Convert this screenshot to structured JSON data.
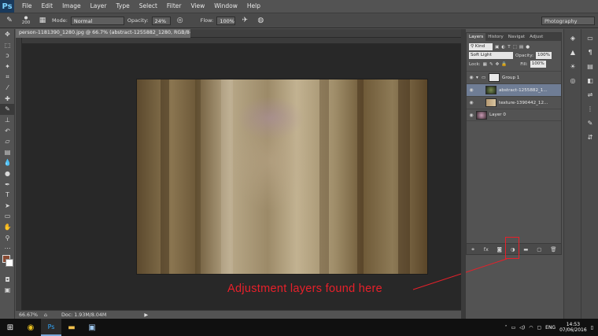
{
  "app": {
    "logo": "Ps"
  },
  "menu": [
    "File",
    "Edit",
    "Image",
    "Layer",
    "Type",
    "Select",
    "Filter",
    "View",
    "Window",
    "Help"
  ],
  "options": {
    "brush_size": "200",
    "mode_label": "Mode:",
    "mode_value": "Normal",
    "opacity_label": "Opacity:",
    "opacity_value": "24%",
    "flow_label": "Flow:",
    "flow_value": "100%",
    "workspace": "Photography"
  },
  "document": {
    "tab_title": "person-1181390_1280.jpg @ 66.7% (abstract-1255882_1280, RGB/8#) *",
    "zoom": "66.67%",
    "doc_info": "Doc: 1.93M/8.04M"
  },
  "layers_panel": {
    "tabs": [
      "Layers",
      "History",
      "Navigat",
      "Adjust"
    ],
    "filter_kind": "Kind",
    "blend_mode": "Soft Light",
    "opacity_label": "Opacity:",
    "opacity_value": "100%",
    "lock_label": "Lock:",
    "fill_label": "Fill:",
    "fill_value": "100%",
    "layers": [
      {
        "name": "Group 1",
        "type": "group"
      },
      {
        "name": "abstract-1255882_1...",
        "type": "layer",
        "selected": true
      },
      {
        "name": "texture-1390442_12...",
        "type": "layer"
      },
      {
        "name": "Layer 0",
        "type": "layer"
      }
    ],
    "footer_icons": [
      "link-icon",
      "fx-icon",
      "mask-icon",
      "adjustment-icon",
      "folder-icon",
      "new-layer-icon",
      "trash-icon"
    ]
  },
  "annotation": {
    "text": "Adjustment layers found here",
    "color": "#e8202a"
  },
  "taskbar": {
    "language": "ENG",
    "time": "14:53",
    "date": "07/06/2016"
  }
}
